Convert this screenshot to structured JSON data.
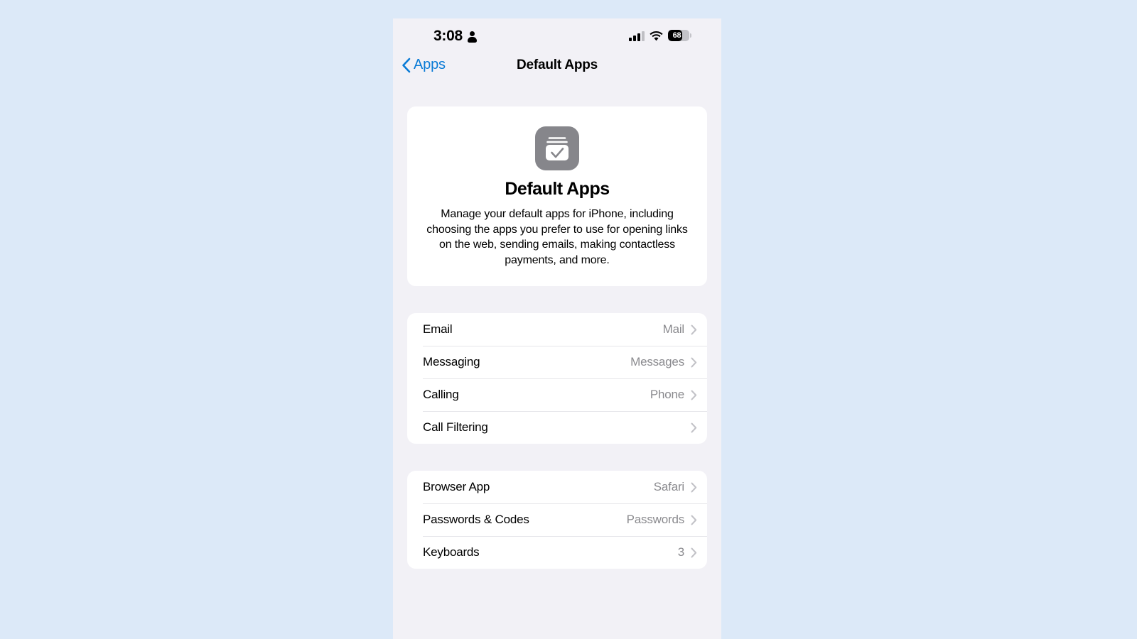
{
  "theme": {
    "page_background": "#dce9f8",
    "screen_background": "#f2f1f6",
    "card_background": "#ffffff",
    "accent": "#0a7bd6",
    "secondary_text": "#8a8a8e",
    "separator": "#e6e6ea",
    "app_icon_background": "#86868b"
  },
  "status_bar": {
    "time": "3:08",
    "person_icon": "person-icon",
    "signal_icon": "cellular-signal-icon",
    "signal_bars_filled": 3,
    "signal_bars_total": 4,
    "wifi_icon": "wifi-icon",
    "battery_icon": "battery-icon",
    "battery_level": "68",
    "battery_percent": 68
  },
  "nav_bar": {
    "back_icon": "chevron-left-icon",
    "back_label": "Apps",
    "title": "Default Apps"
  },
  "hero": {
    "icon": "default-apps-icon",
    "title": "Default Apps",
    "description": "Manage your default apps for iPhone, including choosing the apps you prefer to use for opening links on the web, sending emails, making contactless payments, and more."
  },
  "groups": [
    {
      "id": "communication",
      "rows": [
        {
          "label": "Email",
          "value": "Mail",
          "chevron": "chevron-right-icon"
        },
        {
          "label": "Messaging",
          "value": "Messages",
          "chevron": "chevron-right-icon"
        },
        {
          "label": "Calling",
          "value": "Phone",
          "chevron": "chevron-right-icon"
        },
        {
          "label": "Call Filtering",
          "value": "",
          "chevron": "chevron-right-icon"
        }
      ]
    },
    {
      "id": "web-and-input",
      "rows": [
        {
          "label": "Browser App",
          "value": "Safari",
          "chevron": "chevron-right-icon"
        },
        {
          "label": "Passwords & Codes",
          "value": "Passwords",
          "chevron": "chevron-right-icon"
        },
        {
          "label": "Keyboards",
          "value": "3",
          "chevron": "chevron-right-icon"
        }
      ]
    }
  ]
}
